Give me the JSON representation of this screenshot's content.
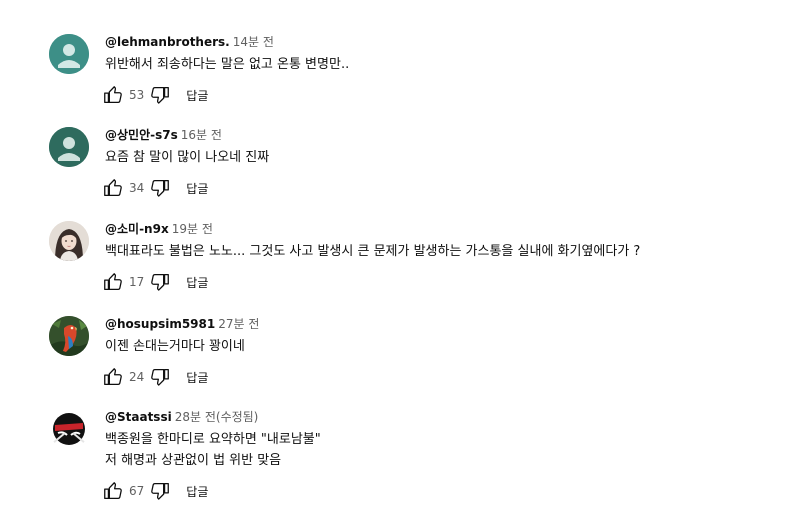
{
  "comments": [
    {
      "author": "@lehmanbrothers.",
      "time": "14분 전",
      "lines": [
        "위반해서 죄송하다는 말은 없고 온통 변명만.."
      ],
      "likes": "53",
      "reply_label": "답글",
      "avatar": {
        "type": "default",
        "bg": "#3d8f87"
      }
    },
    {
      "author": "@상민안-s7s",
      "time": "16분 전",
      "lines": [
        "요즘 참 말이 많이 나오네 진짜"
      ],
      "likes": "34",
      "reply_label": "답글",
      "avatar": {
        "type": "default",
        "bg": "#2e6b5e"
      }
    },
    {
      "author": "@소미-n9x",
      "time": "19분 전",
      "lines": [
        "백대표라도 불법은 노노... 그것도 사고 발생시 큰 문제가 발생하는 가스통을 실내에 화기옆에다가 ?"
      ],
      "likes": "17",
      "reply_label": "답글",
      "avatar": {
        "type": "photo-person",
        "bg": "#d9d2cc"
      }
    },
    {
      "author": "@hosupsim5981",
      "time": "27분 전",
      "lines": [
        "이젠 손대는거마다 꽝이네"
      ],
      "likes": "24",
      "reply_label": "답글",
      "avatar": {
        "type": "photo-parrot",
        "bg": "#2f4a2a"
      }
    },
    {
      "author": "@Staatssi",
      "time": "28분 전(수정됨)",
      "lines": [
        "백종원을 한마디로 요약하면 \"내로남불\"",
        "저 해명과 상관없이 법 위반 맞음"
      ],
      "likes": "67",
      "reply_label": "답글",
      "avatar": {
        "type": "logo-ninja",
        "bg": "#ffffff"
      }
    }
  ]
}
